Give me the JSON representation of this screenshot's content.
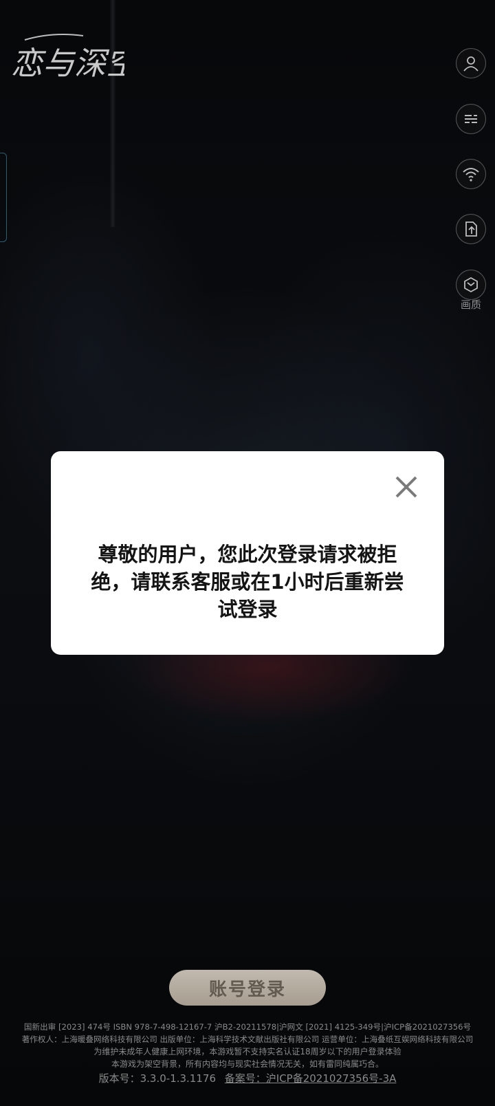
{
  "app": {
    "logo_text": "恋与深空"
  },
  "side_menu": {
    "quality_label": "画质"
  },
  "dialog": {
    "message": "尊敬的用户，您此次登录请求被拒绝，请联系客服或在1小时后重新尝试登录"
  },
  "login": {
    "button_label": "账号登录"
  },
  "legal": {
    "line1": "国新出审 [2023] 474号  ISBN 978-7-498-12167-7  沪B2-20211578|沪网文 [2021] 4125-349号|沪ICP备2021027356号",
    "line2": "著作权人：上海暖叠网络科技有限公司  出版单位：上海科学技术文献出版社有限公司  运营单位：上海叠纸互娱网络科技有限公司",
    "line3": "为维护未成年人健康上网环境，本游戏暂不支持实名认证18周岁以下的用户登录体验",
    "line4": "本游戏为架空背景，所有内容均与现实社会情况无关，如有雷同纯属巧合。",
    "version": "版本号：3.3.0-1.3.1176",
    "record": "备案号：沪ICP备2021027356号-3A"
  }
}
